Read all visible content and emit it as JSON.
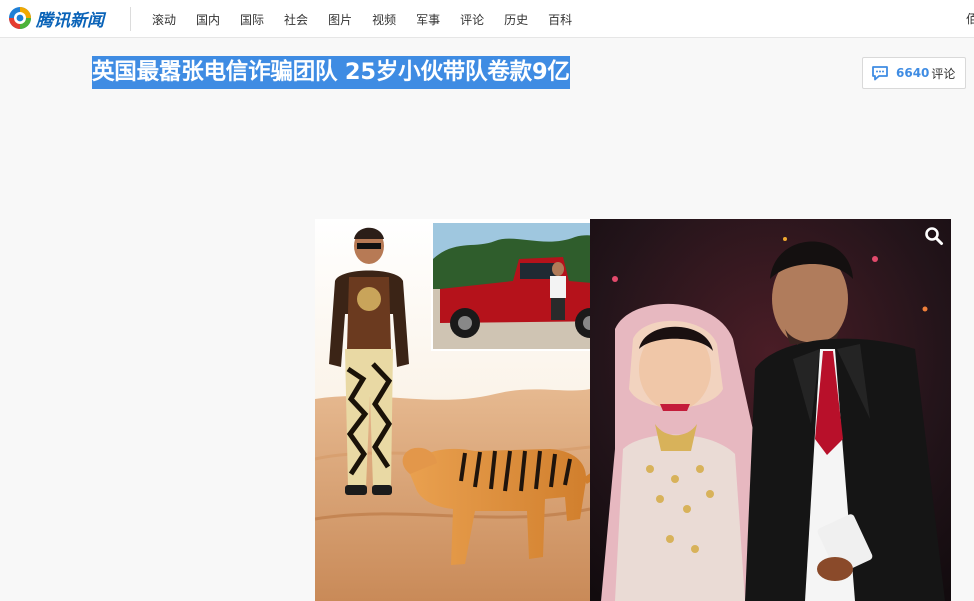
{
  "header": {
    "logo_text": "腾讯新闻",
    "nav": [
      "滚动",
      "国内",
      "国际",
      "社会",
      "图片",
      "视频",
      "军事",
      "评论",
      "历史",
      "百科"
    ],
    "nav_overflow": "佰"
  },
  "article": {
    "title": "英国最嚣张电信诈骗团队 25岁小伙带队卷款9亿"
  },
  "comments": {
    "count": "6640",
    "label": "评论"
  },
  "icons": {
    "logo": "tencent-news-logo-icon",
    "comment": "comment-bubble-icon",
    "zoom": "magnifier-icon"
  },
  "colors": {
    "brand_blue": "#0a63b8",
    "selection_blue": "#3f8ce3",
    "comment_count": "#3f8ce3"
  }
}
